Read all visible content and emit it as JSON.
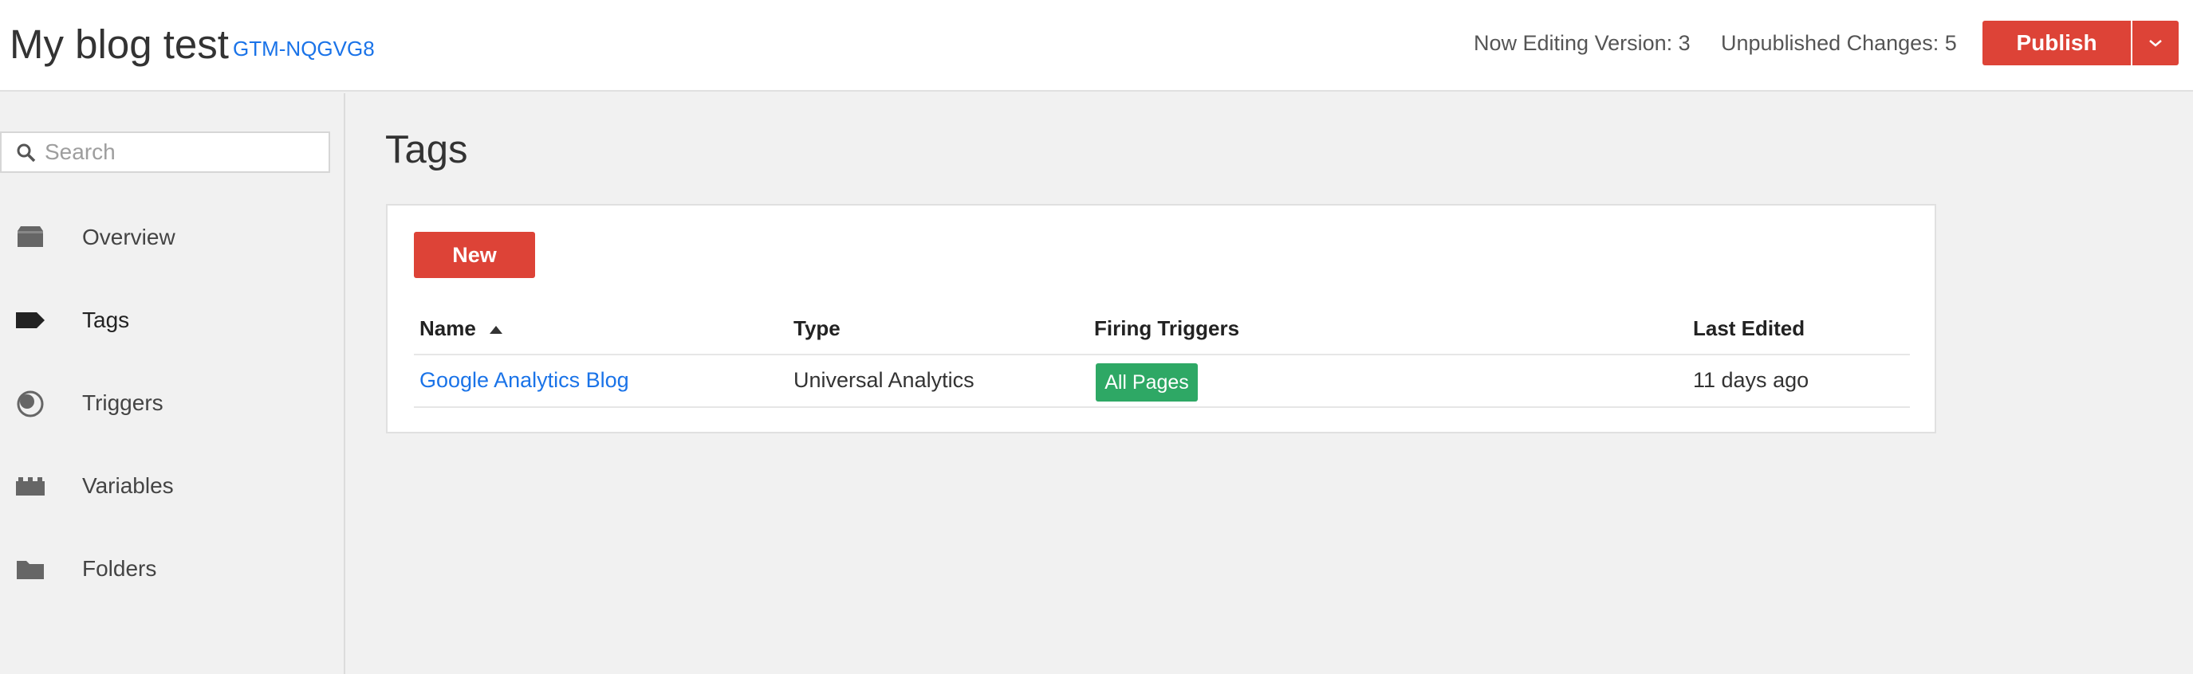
{
  "header": {
    "container_name": "My blog test",
    "container_id": "GTM-NQGVG8",
    "version_text": "Now Editing Version: 3",
    "changes_text": "Unpublished Changes: 5",
    "publish_label": "Publish"
  },
  "sidebar": {
    "search_placeholder": "Search",
    "items": [
      {
        "label": "Overview",
        "icon": "overview-icon"
      },
      {
        "label": "Tags",
        "icon": "tag-icon",
        "active": true
      },
      {
        "label": "Triggers",
        "icon": "trigger-icon"
      },
      {
        "label": "Variables",
        "icon": "variables-icon"
      },
      {
        "label": "Folders",
        "icon": "folder-icon"
      }
    ]
  },
  "main": {
    "title": "Tags",
    "new_label": "New",
    "table": {
      "headers": [
        "Name",
        "Type",
        "Firing Triggers",
        "Last Edited"
      ],
      "rows": [
        {
          "name": "Google Analytics Blog",
          "type": "Universal Analytics",
          "trigger": "All Pages",
          "last_edited": "11 days ago"
        }
      ]
    }
  },
  "colors": {
    "accent_red": "#dd4337",
    "link_blue": "#1a73e8",
    "trigger_green": "#2ea865"
  }
}
